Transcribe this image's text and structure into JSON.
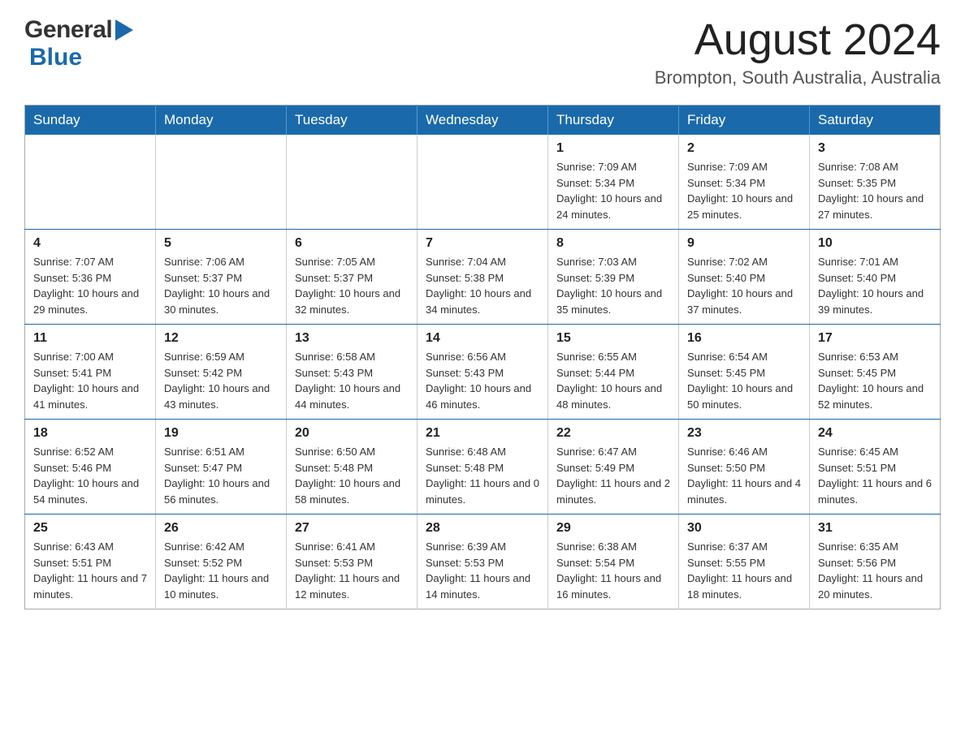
{
  "header": {
    "logo_general": "General",
    "logo_blue": "Blue",
    "month_year": "August 2024",
    "location": "Brompton, South Australia, Australia"
  },
  "days_of_week": [
    "Sunday",
    "Monday",
    "Tuesday",
    "Wednesday",
    "Thursday",
    "Friday",
    "Saturday"
  ],
  "weeks": [
    [
      {
        "day": "",
        "info": ""
      },
      {
        "day": "",
        "info": ""
      },
      {
        "day": "",
        "info": ""
      },
      {
        "day": "",
        "info": ""
      },
      {
        "day": "1",
        "info": "Sunrise: 7:09 AM\nSunset: 5:34 PM\nDaylight: 10 hours and 24 minutes."
      },
      {
        "day": "2",
        "info": "Sunrise: 7:09 AM\nSunset: 5:34 PM\nDaylight: 10 hours and 25 minutes."
      },
      {
        "day": "3",
        "info": "Sunrise: 7:08 AM\nSunset: 5:35 PM\nDaylight: 10 hours and 27 minutes."
      }
    ],
    [
      {
        "day": "4",
        "info": "Sunrise: 7:07 AM\nSunset: 5:36 PM\nDaylight: 10 hours and 29 minutes."
      },
      {
        "day": "5",
        "info": "Sunrise: 7:06 AM\nSunset: 5:37 PM\nDaylight: 10 hours and 30 minutes."
      },
      {
        "day": "6",
        "info": "Sunrise: 7:05 AM\nSunset: 5:37 PM\nDaylight: 10 hours and 32 minutes."
      },
      {
        "day": "7",
        "info": "Sunrise: 7:04 AM\nSunset: 5:38 PM\nDaylight: 10 hours and 34 minutes."
      },
      {
        "day": "8",
        "info": "Sunrise: 7:03 AM\nSunset: 5:39 PM\nDaylight: 10 hours and 35 minutes."
      },
      {
        "day": "9",
        "info": "Sunrise: 7:02 AM\nSunset: 5:40 PM\nDaylight: 10 hours and 37 minutes."
      },
      {
        "day": "10",
        "info": "Sunrise: 7:01 AM\nSunset: 5:40 PM\nDaylight: 10 hours and 39 minutes."
      }
    ],
    [
      {
        "day": "11",
        "info": "Sunrise: 7:00 AM\nSunset: 5:41 PM\nDaylight: 10 hours and 41 minutes."
      },
      {
        "day": "12",
        "info": "Sunrise: 6:59 AM\nSunset: 5:42 PM\nDaylight: 10 hours and 43 minutes."
      },
      {
        "day": "13",
        "info": "Sunrise: 6:58 AM\nSunset: 5:43 PM\nDaylight: 10 hours and 44 minutes."
      },
      {
        "day": "14",
        "info": "Sunrise: 6:56 AM\nSunset: 5:43 PM\nDaylight: 10 hours and 46 minutes."
      },
      {
        "day": "15",
        "info": "Sunrise: 6:55 AM\nSunset: 5:44 PM\nDaylight: 10 hours and 48 minutes."
      },
      {
        "day": "16",
        "info": "Sunrise: 6:54 AM\nSunset: 5:45 PM\nDaylight: 10 hours and 50 minutes."
      },
      {
        "day": "17",
        "info": "Sunrise: 6:53 AM\nSunset: 5:45 PM\nDaylight: 10 hours and 52 minutes."
      }
    ],
    [
      {
        "day": "18",
        "info": "Sunrise: 6:52 AM\nSunset: 5:46 PM\nDaylight: 10 hours and 54 minutes."
      },
      {
        "day": "19",
        "info": "Sunrise: 6:51 AM\nSunset: 5:47 PM\nDaylight: 10 hours and 56 minutes."
      },
      {
        "day": "20",
        "info": "Sunrise: 6:50 AM\nSunset: 5:48 PM\nDaylight: 10 hours and 58 minutes."
      },
      {
        "day": "21",
        "info": "Sunrise: 6:48 AM\nSunset: 5:48 PM\nDaylight: 11 hours and 0 minutes."
      },
      {
        "day": "22",
        "info": "Sunrise: 6:47 AM\nSunset: 5:49 PM\nDaylight: 11 hours and 2 minutes."
      },
      {
        "day": "23",
        "info": "Sunrise: 6:46 AM\nSunset: 5:50 PM\nDaylight: 11 hours and 4 minutes."
      },
      {
        "day": "24",
        "info": "Sunrise: 6:45 AM\nSunset: 5:51 PM\nDaylight: 11 hours and 6 minutes."
      }
    ],
    [
      {
        "day": "25",
        "info": "Sunrise: 6:43 AM\nSunset: 5:51 PM\nDaylight: 11 hours and 7 minutes."
      },
      {
        "day": "26",
        "info": "Sunrise: 6:42 AM\nSunset: 5:52 PM\nDaylight: 11 hours and 10 minutes."
      },
      {
        "day": "27",
        "info": "Sunrise: 6:41 AM\nSunset: 5:53 PM\nDaylight: 11 hours and 12 minutes."
      },
      {
        "day": "28",
        "info": "Sunrise: 6:39 AM\nSunset: 5:53 PM\nDaylight: 11 hours and 14 minutes."
      },
      {
        "day": "29",
        "info": "Sunrise: 6:38 AM\nSunset: 5:54 PM\nDaylight: 11 hours and 16 minutes."
      },
      {
        "day": "30",
        "info": "Sunrise: 6:37 AM\nSunset: 5:55 PM\nDaylight: 11 hours and 18 minutes."
      },
      {
        "day": "31",
        "info": "Sunrise: 6:35 AM\nSunset: 5:56 PM\nDaylight: 11 hours and 20 minutes."
      }
    ]
  ]
}
